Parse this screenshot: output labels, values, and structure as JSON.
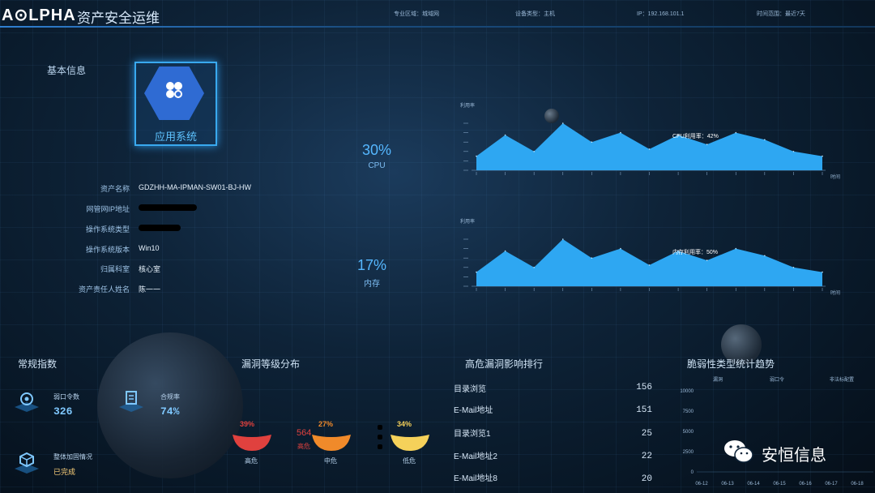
{
  "header": {
    "logo": "A⊙LPHA",
    "title": "资产安全运维",
    "items": [
      "专业区域：城域网",
      "设备类型：主机",
      "IP：192.168.101.1",
      "时间范围：最近7天"
    ]
  },
  "basic_info": {
    "title": "基本信息",
    "app_label": "应用系统",
    "fields": [
      {
        "label": "资产名称",
        "value": "GDZHH-MA-IPMAN-SW01-BJ-HW"
      },
      {
        "label": "网管网IP地址",
        "value": ""
      },
      {
        "label": "操作系统类型",
        "value": ""
      },
      {
        "label": "操作系统版本",
        "value": "Win10"
      },
      {
        "label": "归属科室",
        "value": "核心室"
      },
      {
        "label": "资产责任人姓名",
        "value": "陈一一"
      }
    ],
    "cpu": {
      "value": "30%",
      "label": "CPU"
    },
    "memory": {
      "value": "17%",
      "label": "内存"
    }
  },
  "colors": {
    "accent": "#39a9ef",
    "chart_fill": "#2ea7f2",
    "gauge_high": "#e0413e",
    "gauge_mid": "#f08a2a",
    "gauge_low": "#f5d15a"
  },
  "chart_data": [
    {
      "type": "area",
      "ylabel": "利用率",
      "xlabel": "时间",
      "annotation": "CPU利用率：42%",
      "values": [
        30,
        75,
        40,
        100,
        60,
        80,
        45,
        75,
        55,
        80,
        65,
        40,
        30
      ]
    },
    {
      "type": "area",
      "ylabel": "利用率",
      "xlabel": "时间",
      "annotation": "内存利用率：50%",
      "values": [
        30,
        75,
        40,
        100,
        60,
        80,
        45,
        75,
        55,
        80,
        65,
        40,
        30
      ]
    }
  ],
  "regular_index": {
    "title": "常规指数",
    "items": [
      {
        "label": "弱口令数",
        "value": "326",
        "icon": "gear-icon"
      },
      {
        "label": "合规率",
        "value": "74%",
        "icon": "document-icon"
      },
      {
        "label": "整体加固情况",
        "value": "已完成",
        "icon": "cube-icon"
      }
    ]
  },
  "vuln_levels": {
    "title": "漏洞等级分布",
    "gauges": [
      {
        "pct": "39%",
        "label": "高危",
        "color": "#e0413e",
        "fraction": 0.39
      },
      {
        "pct": "27%",
        "label": "中危",
        "color": "#f08a2a",
        "fraction": 0.27
      },
      {
        "pct": "34%",
        "label": "低危",
        "color": "#f5d15a",
        "fraction": 0.34
      }
    ],
    "overlay_num": "564",
    "overlay_label": "高危"
  },
  "ranking": {
    "title": "高危漏洞影响排行",
    "items": [
      {
        "name": "目录浏览",
        "value": "156"
      },
      {
        "name": "E-Mail地址",
        "value": "151"
      },
      {
        "name": "目录浏览1",
        "value": "25"
      },
      {
        "name": "E-Mail地址2",
        "value": "22"
      },
      {
        "name": "E-Mail地址8",
        "value": "20"
      }
    ]
  },
  "trend": {
    "title": "脆弱性类型统计趋势",
    "legend": [
      "漏洞",
      "弱口令",
      "非法标配置"
    ],
    "yticks": [
      "10000",
      "7500",
      "5000",
      "2500",
      "0"
    ],
    "xticks": [
      "06-12",
      "06-13",
      "06-14",
      "06-15",
      "06-16",
      "06-17",
      "06-18"
    ]
  },
  "watermark": "安恒信息"
}
